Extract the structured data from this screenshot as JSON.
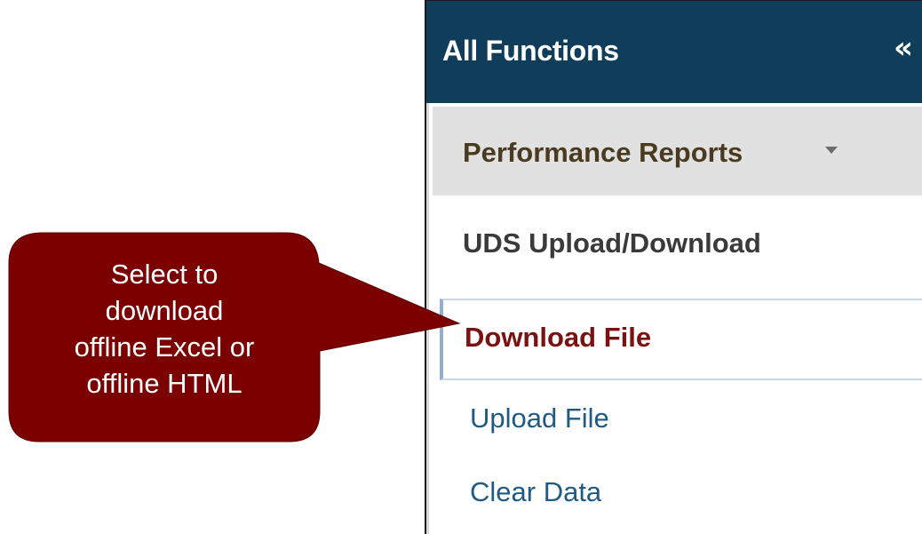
{
  "sidebar": {
    "title": "All Functions",
    "collapse_icon": "«",
    "group": {
      "label": "Performance Reports",
      "expanded": true,
      "caret_icon": "caret-down-icon"
    },
    "subgroup": {
      "label": "UDS Upload/Download"
    },
    "items": [
      {
        "label": "Download File",
        "active": true
      },
      {
        "label": "Upload File",
        "active": false
      },
      {
        "label": "Clear Data",
        "active": false
      }
    ]
  },
  "callout": {
    "lines": [
      "Select to",
      "download",
      "offline Excel or",
      "offline HTML"
    ],
    "color": "#7b0000"
  },
  "colors": {
    "header_bg": "#103d5a",
    "group_bg": "#e1e1e1",
    "active_text": "#7a1212",
    "link_text": "#1f5a85"
  }
}
